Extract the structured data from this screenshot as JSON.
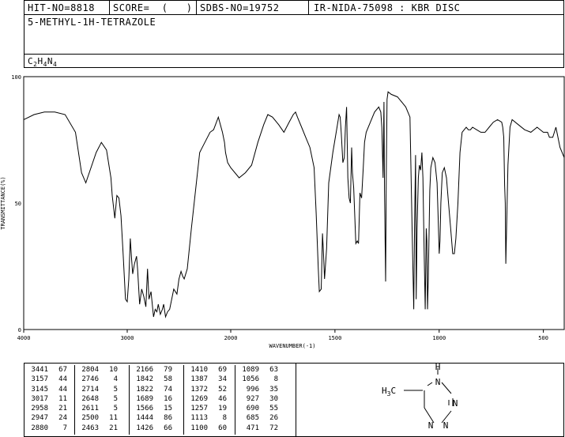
{
  "header": {
    "hit_no": "HIT-NO=8818",
    "score": "SCORE=  (   )",
    "sdbs_no": "SDBS-NO=19752",
    "ir_info": "IR-NIDA-75098 : KBR DISC",
    "compound_name": "5-METHYL-1H-TETRAZOLE",
    "formula_parts": [
      "C",
      "2",
      "H",
      "4",
      "N",
      "4"
    ]
  },
  "chart_data": {
    "type": "line",
    "xlabel": "WAVENUMBER(-1)",
    "ylabel": "TRANSMITTANCE(%)",
    "xlim": [
      4000,
      400
    ],
    "ylim": [
      0,
      100
    ],
    "x_ticks": [
      "4000",
      "3000",
      "2000",
      "1500",
      "1000",
      "500"
    ],
    "y_ticks": [
      "100",
      "50",
      "0"
    ],
    "series": [
      {
        "x": [
          4000,
          3900,
          3800,
          3700,
          3600,
          3500,
          3441,
          3400,
          3300,
          3250,
          3200,
          3157,
          3145,
          3120,
          3100,
          3080,
          3060,
          3040,
          3017,
          3000,
          2985,
          2970,
          2958,
          2947,
          2930,
          2910,
          2900,
          2880,
          2860,
          2840,
          2820,
          2804,
          2790,
          2770,
          2746,
          2730,
          2714,
          2700,
          2680,
          2660,
          2648,
          2630,
          2611,
          2590,
          2570,
          2550,
          2520,
          2500,
          2480,
          2463,
          2450,
          2420,
          2380,
          2300,
          2200,
          2166,
          2120,
          2080,
          2060,
          2050,
          2030,
          2000,
          1960,
          1930,
          1900,
          1870,
          1842,
          1822,
          1800,
          1770,
          1745,
          1720,
          1700,
          1689,
          1680,
          1660,
          1640,
          1620,
          1600,
          1590,
          1580,
          1575,
          1566,
          1560,
          1555,
          1550,
          1540,
          1530,
          1510,
          1490,
          1480,
          1475,
          1470,
          1462,
          1455,
          1450,
          1444,
          1438,
          1432,
          1426,
          1420,
          1416,
          1410,
          1400,
          1393,
          1387,
          1380,
          1372,
          1364,
          1358,
          1350,
          1330,
          1310,
          1290,
          1280,
          1275,
          1269,
          1265,
          1262,
          1257,
          1254,
          1250,
          1245,
          1230,
          1200,
          1180,
          1160,
          1140,
          1130,
          1122,
          1118,
          1113,
          1110,
          1106,
          1100,
          1095,
          1089,
          1083,
          1078,
          1072,
          1067,
          1062,
          1059,
          1056,
          1052,
          1045,
          1040,
          1030,
          1020,
          1010,
          1005,
          1000,
          996,
          992,
          985,
          975,
          965,
          955,
          945,
          935,
          927,
          920,
          910,
          900,
          890,
          880,
          870,
          860,
          850,
          840,
          820,
          800,
          780,
          760,
          740,
          720,
          700,
          695,
          690,
          686,
          683,
          680,
          670,
          660,
          650,
          620,
          590,
          560,
          530,
          500,
          480,
          471,
          455,
          440,
          420,
          400
        ],
        "y": [
          83,
          85,
          86,
          86,
          85,
          78,
          62,
          58,
          70,
          74,
          71,
          60,
          53,
          44,
          53,
          52,
          45,
          30,
          12,
          11,
          20,
          36,
          28,
          22,
          26,
          29,
          24,
          10,
          16,
          13,
          9,
          24,
          12,
          15,
          5,
          8,
          7,
          10,
          6,
          8,
          10,
          5,
          7,
          8,
          12,
          16,
          14,
          20,
          23,
          21,
          20,
          24,
          40,
          70,
          78,
          79,
          84,
          78,
          74,
          70,
          66,
          64,
          60,
          62,
          65,
          74,
          81,
          85,
          84,
          81,
          78,
          82,
          85,
          86,
          84,
          80,
          76,
          72,
          64,
          46,
          24,
          15,
          16,
          38,
          30,
          20,
          32,
          58,
          70,
          80,
          85,
          84,
          78,
          66,
          68,
          80,
          88,
          60,
          52,
          50,
          72,
          62,
          56,
          34,
          35,
          34,
          54,
          52,
          64,
          74,
          78,
          82,
          86,
          88,
          86,
          80,
          60,
          90,
          55,
          19,
          60,
          91,
          94,
          93,
          92,
          90,
          88,
          84,
          40,
          8,
          40,
          69,
          12,
          40,
          60,
          65,
          63,
          70,
          60,
          30,
          8,
          40,
          35,
          8,
          20,
          55,
          64,
          68,
          66,
          58,
          45,
          30,
          35,
          50,
          62,
          64,
          60,
          50,
          40,
          30,
          30,
          36,
          50,
          70,
          78,
          79,
          80,
          79,
          79,
          80,
          79,
          78,
          78,
          80,
          82,
          83,
          82,
          80,
          76,
          57,
          50,
          26,
          65,
          80,
          83,
          81,
          79,
          78,
          80,
          78,
          78,
          76,
          76,
          80,
          72,
          68
        ]
      }
    ]
  },
  "peak_table": {
    "columns": [
      [
        [
          "3441",
          "67"
        ],
        [
          "3157",
          "44"
        ],
        [
          "3145",
          "44"
        ],
        [
          "3017",
          "11"
        ],
        [
          "2958",
          "21"
        ],
        [
          "2947",
          "24"
        ],
        [
          "2880",
          "7"
        ]
      ],
      [
        [
          "2804",
          "10"
        ],
        [
          "2746",
          "4"
        ],
        [
          "2714",
          "5"
        ],
        [
          "2648",
          "5"
        ],
        [
          "2611",
          "5"
        ],
        [
          "2500",
          "11"
        ],
        [
          "2463",
          "21"
        ]
      ],
      [
        [
          "2166",
          "79"
        ],
        [
          "1842",
          "58"
        ],
        [
          "1822",
          "74"
        ],
        [
          "1689",
          "16"
        ],
        [
          "1566",
          "15"
        ],
        [
          "1444",
          "86"
        ],
        [
          "1426",
          "66"
        ]
      ],
      [
        [
          "1410",
          "69"
        ],
        [
          "1387",
          "34"
        ],
        [
          "1372",
          "52"
        ],
        [
          "1269",
          "46"
        ],
        [
          "1257",
          "19"
        ],
        [
          "1113",
          "8"
        ],
        [
          "1100",
          "60"
        ]
      ],
      [
        [
          "1089",
          "63"
        ],
        [
          "1056",
          "8"
        ],
        [
          "996",
          "35"
        ],
        [
          "927",
          "30"
        ],
        [
          "690",
          "55"
        ],
        [
          "685",
          "26"
        ],
        [
          "471",
          "72"
        ]
      ]
    ]
  },
  "structure": {
    "atoms": {
      "h_top": "H",
      "n1": "N",
      "n2": "N",
      "n3": "N",
      "n4": "N",
      "ch3_c": "C",
      "ch3_h": "H",
      "ch3_sub": "3"
    }
  }
}
